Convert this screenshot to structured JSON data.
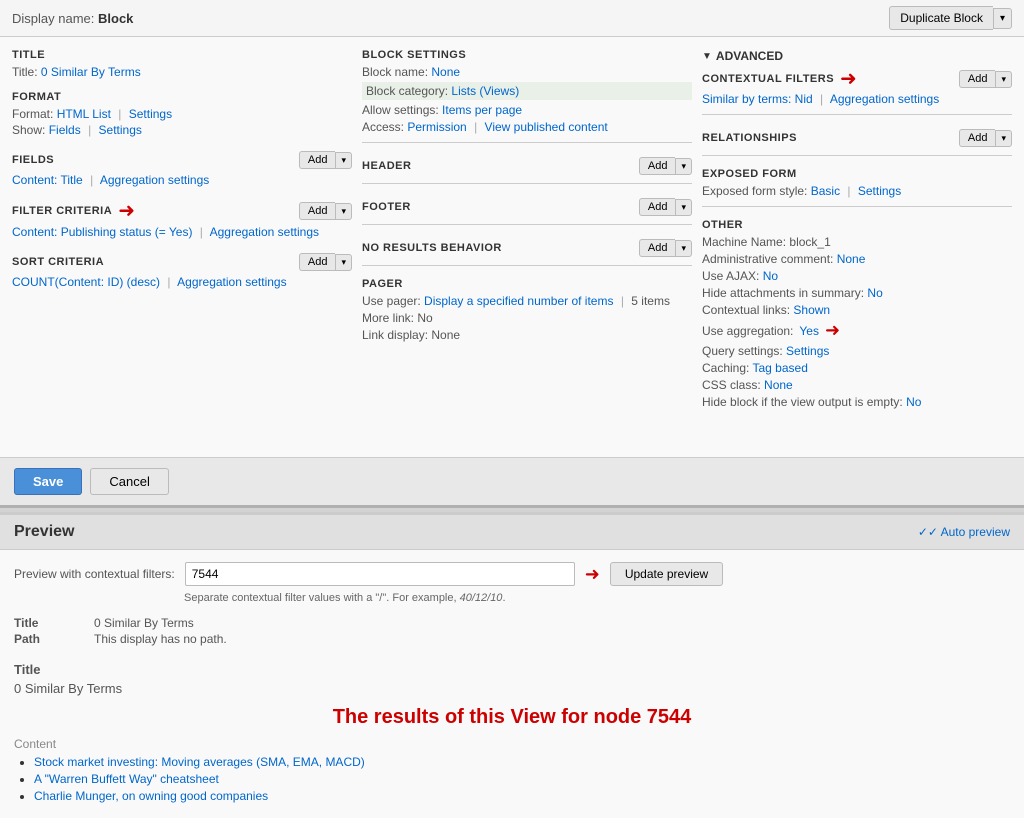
{
  "topbar": {
    "display_name_label": "Display name:",
    "display_name_value": "Block",
    "duplicate_btn": "Duplicate Block",
    "duplicate_arrow": "▾"
  },
  "left_col": {
    "title_section": "TITLE",
    "title_label": "Title:",
    "title_value": "0 Similar By Terms",
    "format_section": "FORMAT",
    "format_label": "Format:",
    "format_value": "HTML List",
    "format_link": "Settings",
    "show_label": "Show:",
    "show_link1": "Fields",
    "show_link2": "Settings",
    "fields_section": "FIELDS",
    "add_btn": "Add",
    "add_arrow": "▾",
    "fields_link1": "Content: Title",
    "fields_link2": "Aggregation settings",
    "filter_section": "FILTER CRITERIA",
    "filter_link1": "Content: Publishing status (= Yes)",
    "filter_link2": "Aggregation settings",
    "sort_section": "SORT CRITERIA",
    "sort_link1": "COUNT(Content: ID) (desc)",
    "sort_link2": "Aggregation settings"
  },
  "mid_col": {
    "block_settings_title": "BLOCK SETTINGS",
    "block_name_label": "Block name:",
    "block_name_value": "None",
    "block_category_label": "Block category:",
    "block_category_value": "Lists (Views)",
    "allow_settings_label": "Allow settings:",
    "allow_settings_value": "Items per page",
    "access_label": "Access:",
    "access_link1": "Permission",
    "access_link2": "View published content",
    "header_title": "HEADER",
    "footer_title": "FOOTER",
    "no_results_title": "NO RESULTS BEHAVIOR",
    "pager_title": "PAGER",
    "use_pager_label": "Use pager:",
    "use_pager_value": "Display a specified number of items",
    "use_pager_count": "5 items",
    "more_link_label": "More link:",
    "more_link_value": "No",
    "link_display_label": "Link display:",
    "link_display_value": "None",
    "add_btn": "Add",
    "add_arrow": "▾"
  },
  "right_col": {
    "advanced_title": "ADVANCED",
    "contextual_filters_title": "CONTEXTUAL FILTERS",
    "add_btn": "Add",
    "add_arrow": "▾",
    "cf_link1": "Similar by terms: Nid",
    "cf_link2": "Aggregation settings",
    "relationships_title": "RELATIONSHIPS",
    "exposed_form_title": "EXPOSED FORM",
    "exposed_label": "Exposed form style:",
    "exposed_link1": "Basic",
    "exposed_link2": "Settings",
    "other_title": "OTHER",
    "machine_name_label": "Machine Name:",
    "machine_name_value": "block_1",
    "admin_comment_label": "Administrative comment:",
    "admin_comment_value": "None",
    "use_ajax_label": "Use AJAX:",
    "use_ajax_value": "No",
    "hide_attach_label": "Hide attachments in summary:",
    "hide_attach_value": "No",
    "contextual_links_label": "Contextual links:",
    "contextual_links_value": "Shown",
    "use_aggregation_label": "Use aggregation:",
    "use_aggregation_value": "Yes",
    "query_settings_label": "Query settings:",
    "query_settings_value": "Settings",
    "caching_label": "Caching:",
    "caching_value": "Tag based",
    "css_class_label": "CSS class:",
    "css_class_value": "None",
    "hide_block_label": "Hide block if the view output is empty:",
    "hide_block_value": "No"
  },
  "actions": {
    "save_btn": "Save",
    "cancel_btn": "Cancel"
  },
  "preview": {
    "title": "Preview",
    "auto_preview": "✓ Auto preview",
    "filter_label": "Preview with contextual filters:",
    "filter_value": "7544",
    "update_btn": "Update preview",
    "note_prefix": "Separate contextual filter values with a \"/\". For example, ",
    "note_example": "40/12/10",
    "note_suffix": ".",
    "table_rows": [
      {
        "key": "Title",
        "value": "0 Similar By Terms"
      },
      {
        "key": "Path",
        "value": "This display has no path."
      }
    ],
    "block_title": "Title",
    "block_title_value": "0 Similar By Terms",
    "main_heading": "The results of this View for node 7544",
    "content_label": "Content",
    "content_items": [
      "Stock market investing: Moving averages (SMA, EMA, MACD)",
      "A \"Warren Buffett Way\" cheatsheet",
      "Charlie Munger, on owning good companies"
    ]
  }
}
